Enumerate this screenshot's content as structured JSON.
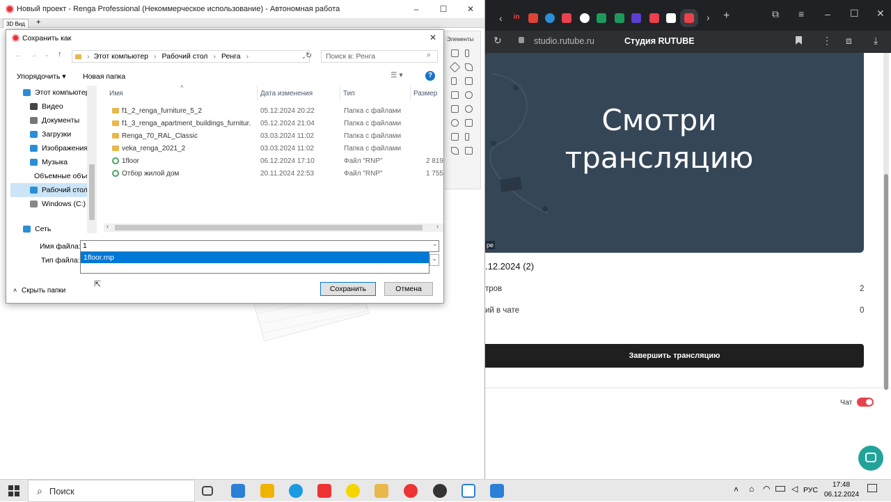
{
  "renga": {
    "title": "Новый проект - Renga Professional (Некоммерческое использование) - Автономная работа",
    "tab": "3D Вид",
    "palette_label": "Элементы"
  },
  "dialog": {
    "title": "Сохранить как",
    "breadcrumb": [
      "Этот компьютер",
      "Рабочий стол",
      "Ренга"
    ],
    "search_placeholder": "Поиск в: Ренга",
    "toolbar": {
      "organize": "Упорядочить ▾",
      "new_folder": "Новая папка"
    },
    "nav": [
      {
        "label": "Этот компьютер",
        "icon": "computer-icon",
        "color": "#2a8fd6"
      },
      {
        "label": "Видео",
        "icon": "video-icon",
        "color": "#444"
      },
      {
        "label": "Документы",
        "icon": "documents-icon",
        "color": "#777"
      },
      {
        "label": "Загрузки",
        "icon": "downloads-icon",
        "color": "#2a8fd6"
      },
      {
        "label": "Изображения",
        "icon": "pictures-icon",
        "color": "#2a8fd6"
      },
      {
        "label": "Музыка",
        "icon": "music-icon",
        "color": "#2a8fd6"
      },
      {
        "label": "Объемные объекты",
        "icon": "3d-objects-icon",
        "color": "#23a6e0"
      },
      {
        "label": "Рабочий стол",
        "icon": "desktop-icon",
        "color": "#2a8fd6",
        "selected": true
      },
      {
        "label": "Windows (C:)",
        "icon": "drive-icon",
        "color": "#888"
      },
      {
        "label": "Сеть",
        "icon": "network-icon",
        "color": "#2a8fd6"
      }
    ],
    "columns": {
      "name": "Имя",
      "date": "Дата изменения",
      "type": "Тип",
      "size": "Размер"
    },
    "files": [
      {
        "name": "f1_2_renga_furniture_5_2",
        "date": "05.12.2024 20:22",
        "type": "Папка с файлами",
        "size": "",
        "kind": "folder"
      },
      {
        "name": "f1_3_renga_apartment_buildings_furnitur...",
        "date": "05.12.2024 21:04",
        "type": "Папка с файлами",
        "size": "",
        "kind": "folder"
      },
      {
        "name": "Renga_70_RAL_Classic",
        "date": "03.03.2024 11:02",
        "type": "Папка с файлами",
        "size": "",
        "kind": "folder"
      },
      {
        "name": "veka_renga_2021_2",
        "date": "03.03.2024 11:02",
        "type": "Папка с файлами",
        "size": "",
        "kind": "folder"
      },
      {
        "name": "1floor",
        "date": "06.12.2024 17:10",
        "type": "Файл \"RNP\"",
        "size": "2 819",
        "kind": "rnp"
      },
      {
        "name": "Отбор жилой дом",
        "date": "20.11.2024 22:53",
        "type": "Файл \"RNP\"",
        "size": "1 755",
        "kind": "rnp"
      }
    ],
    "filename_label": "Имя файла:",
    "filename_value": "1",
    "filetype_label": "Тип файла:",
    "autocomplete": "1floor.rnp",
    "hide_folders": "Скрыть папки",
    "save": "Сохранить",
    "cancel": "Отмена"
  },
  "browser": {
    "url": "studio.rutube.ru",
    "page_title": "Студия RUTUBE",
    "hero_text": "Смотри трансляцию",
    "hero_badge": "ре",
    "stream_date": ".12.2024 (2)",
    "stats": [
      {
        "label": "тров",
        "value": "2"
      },
      {
        "label": "ий в чате",
        "value": "0"
      }
    ],
    "end_stream": "Завершить трансляцию",
    "chat_label": "Чат",
    "accent": "#e9414d"
  },
  "taskbar": {
    "search": "Поиск",
    "lang": "РУС",
    "time": "17:48",
    "date": "06.12.2024"
  }
}
